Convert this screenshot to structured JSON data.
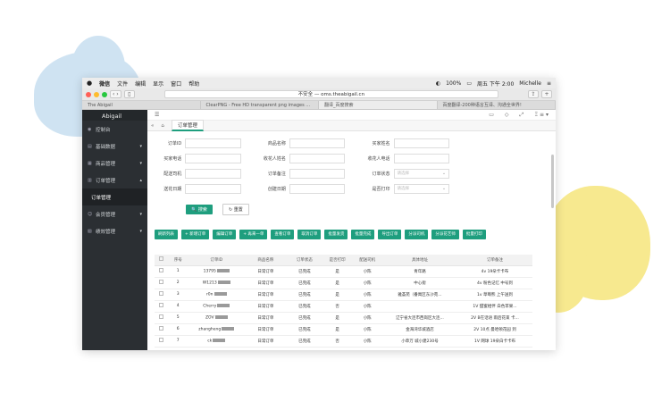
{
  "menubar": {
    "apple": "",
    "app": "微信",
    "items": [
      "文件",
      "编辑",
      "显示",
      "窗口",
      "帮助"
    ],
    "battery": "100%",
    "clock": "周五 下午 2:00",
    "user": "Michelle"
  },
  "browser": {
    "url": "不安全 — oms.theabigail.cn",
    "tabs": [
      "The Abigail",
      "ClearPNG - Free HD transparent png images ...",
      "翻译_百度搜索",
      "百度翻译-200种语言互译、沟通全世界!"
    ]
  },
  "sidebar": {
    "title": "Abigail",
    "items": [
      {
        "label": "控制台"
      },
      {
        "label": "基础数据"
      },
      {
        "label": "商品管理"
      },
      {
        "label": "订单管理"
      },
      {
        "label": "订单管理"
      },
      {
        "label": "会员管理"
      },
      {
        "label": "绩效管理"
      }
    ]
  },
  "topbar": {
    "right": [
      "▭",
      "◇",
      "⤢",
      "Ξ ≡ ▾"
    ]
  },
  "crumb": {
    "tab": "订单管理"
  },
  "form": {
    "row1": [
      "订单ID",
      "商品名称",
      "买家姓名"
    ],
    "row2": [
      "买家电话",
      "收花人姓名",
      "收花人电话"
    ],
    "row3": [
      "配送司机",
      "订单备注",
      "订单状态"
    ],
    "row4": [
      "送花日期",
      "创建日期",
      "是否打印"
    ],
    "select_placeholder": "请选择",
    "search": "搜索",
    "reset": "重置"
  },
  "actions": [
    "刷新列表",
    "+ 新增订单",
    "编辑订单",
    "+ 再来一单",
    "查看订单",
    "取消订单",
    "批量发货",
    "批量完成",
    "导出订单",
    "分派司机",
    "分派花艺师",
    "批量打印"
  ],
  "table": {
    "headers": [
      "",
      "序号",
      "订单ID",
      "商品名称",
      "订单状态",
      "是否打印",
      "配送司机",
      "具体地址",
      "订单备注"
    ],
    "rows": [
      [
        "1",
        "13795",
        "日常订单",
        "已完成",
        "是",
        "小陈",
        "青年路",
        "4v 19朵卡卡布"
      ],
      [
        "2",
        "W1213",
        "日常订单",
        "已完成",
        "是",
        "小陈",
        "中心街",
        "4v 粉色记忆 中号到"
      ],
      [
        "3",
        "r0n",
        "日常订单",
        "已完成",
        "是",
        "小陈",
        "雅荟苑（番禺区东沙苑...",
        "1v 草莓熊 上午送到"
      ],
      [
        "4",
        "Cherry",
        "日常订单",
        "已完成",
        "否",
        "小陈",
        "",
        "1V 甜蜜相伴 白色苹果..."
      ],
      [
        "5",
        "ZOV",
        "日常订单",
        "已完成",
        "是",
        "小陈",
        "辽宁省大连市西岗区大连...",
        "2V B在话语 雨后花束 卡..."
      ],
      [
        "6",
        "zhangheng",
        "日常订单",
        "已完成",
        "是",
        "小陈",
        "金海湾华城酒店",
        "2V 10点 曼哈顿花园 到"
      ],
      [
        "7",
        "ck",
        "日常订单",
        "已完成",
        "否",
        "小陈",
        "小草万 城小建230号",
        "1V 网球 19朵白卡卡布"
      ]
    ]
  }
}
